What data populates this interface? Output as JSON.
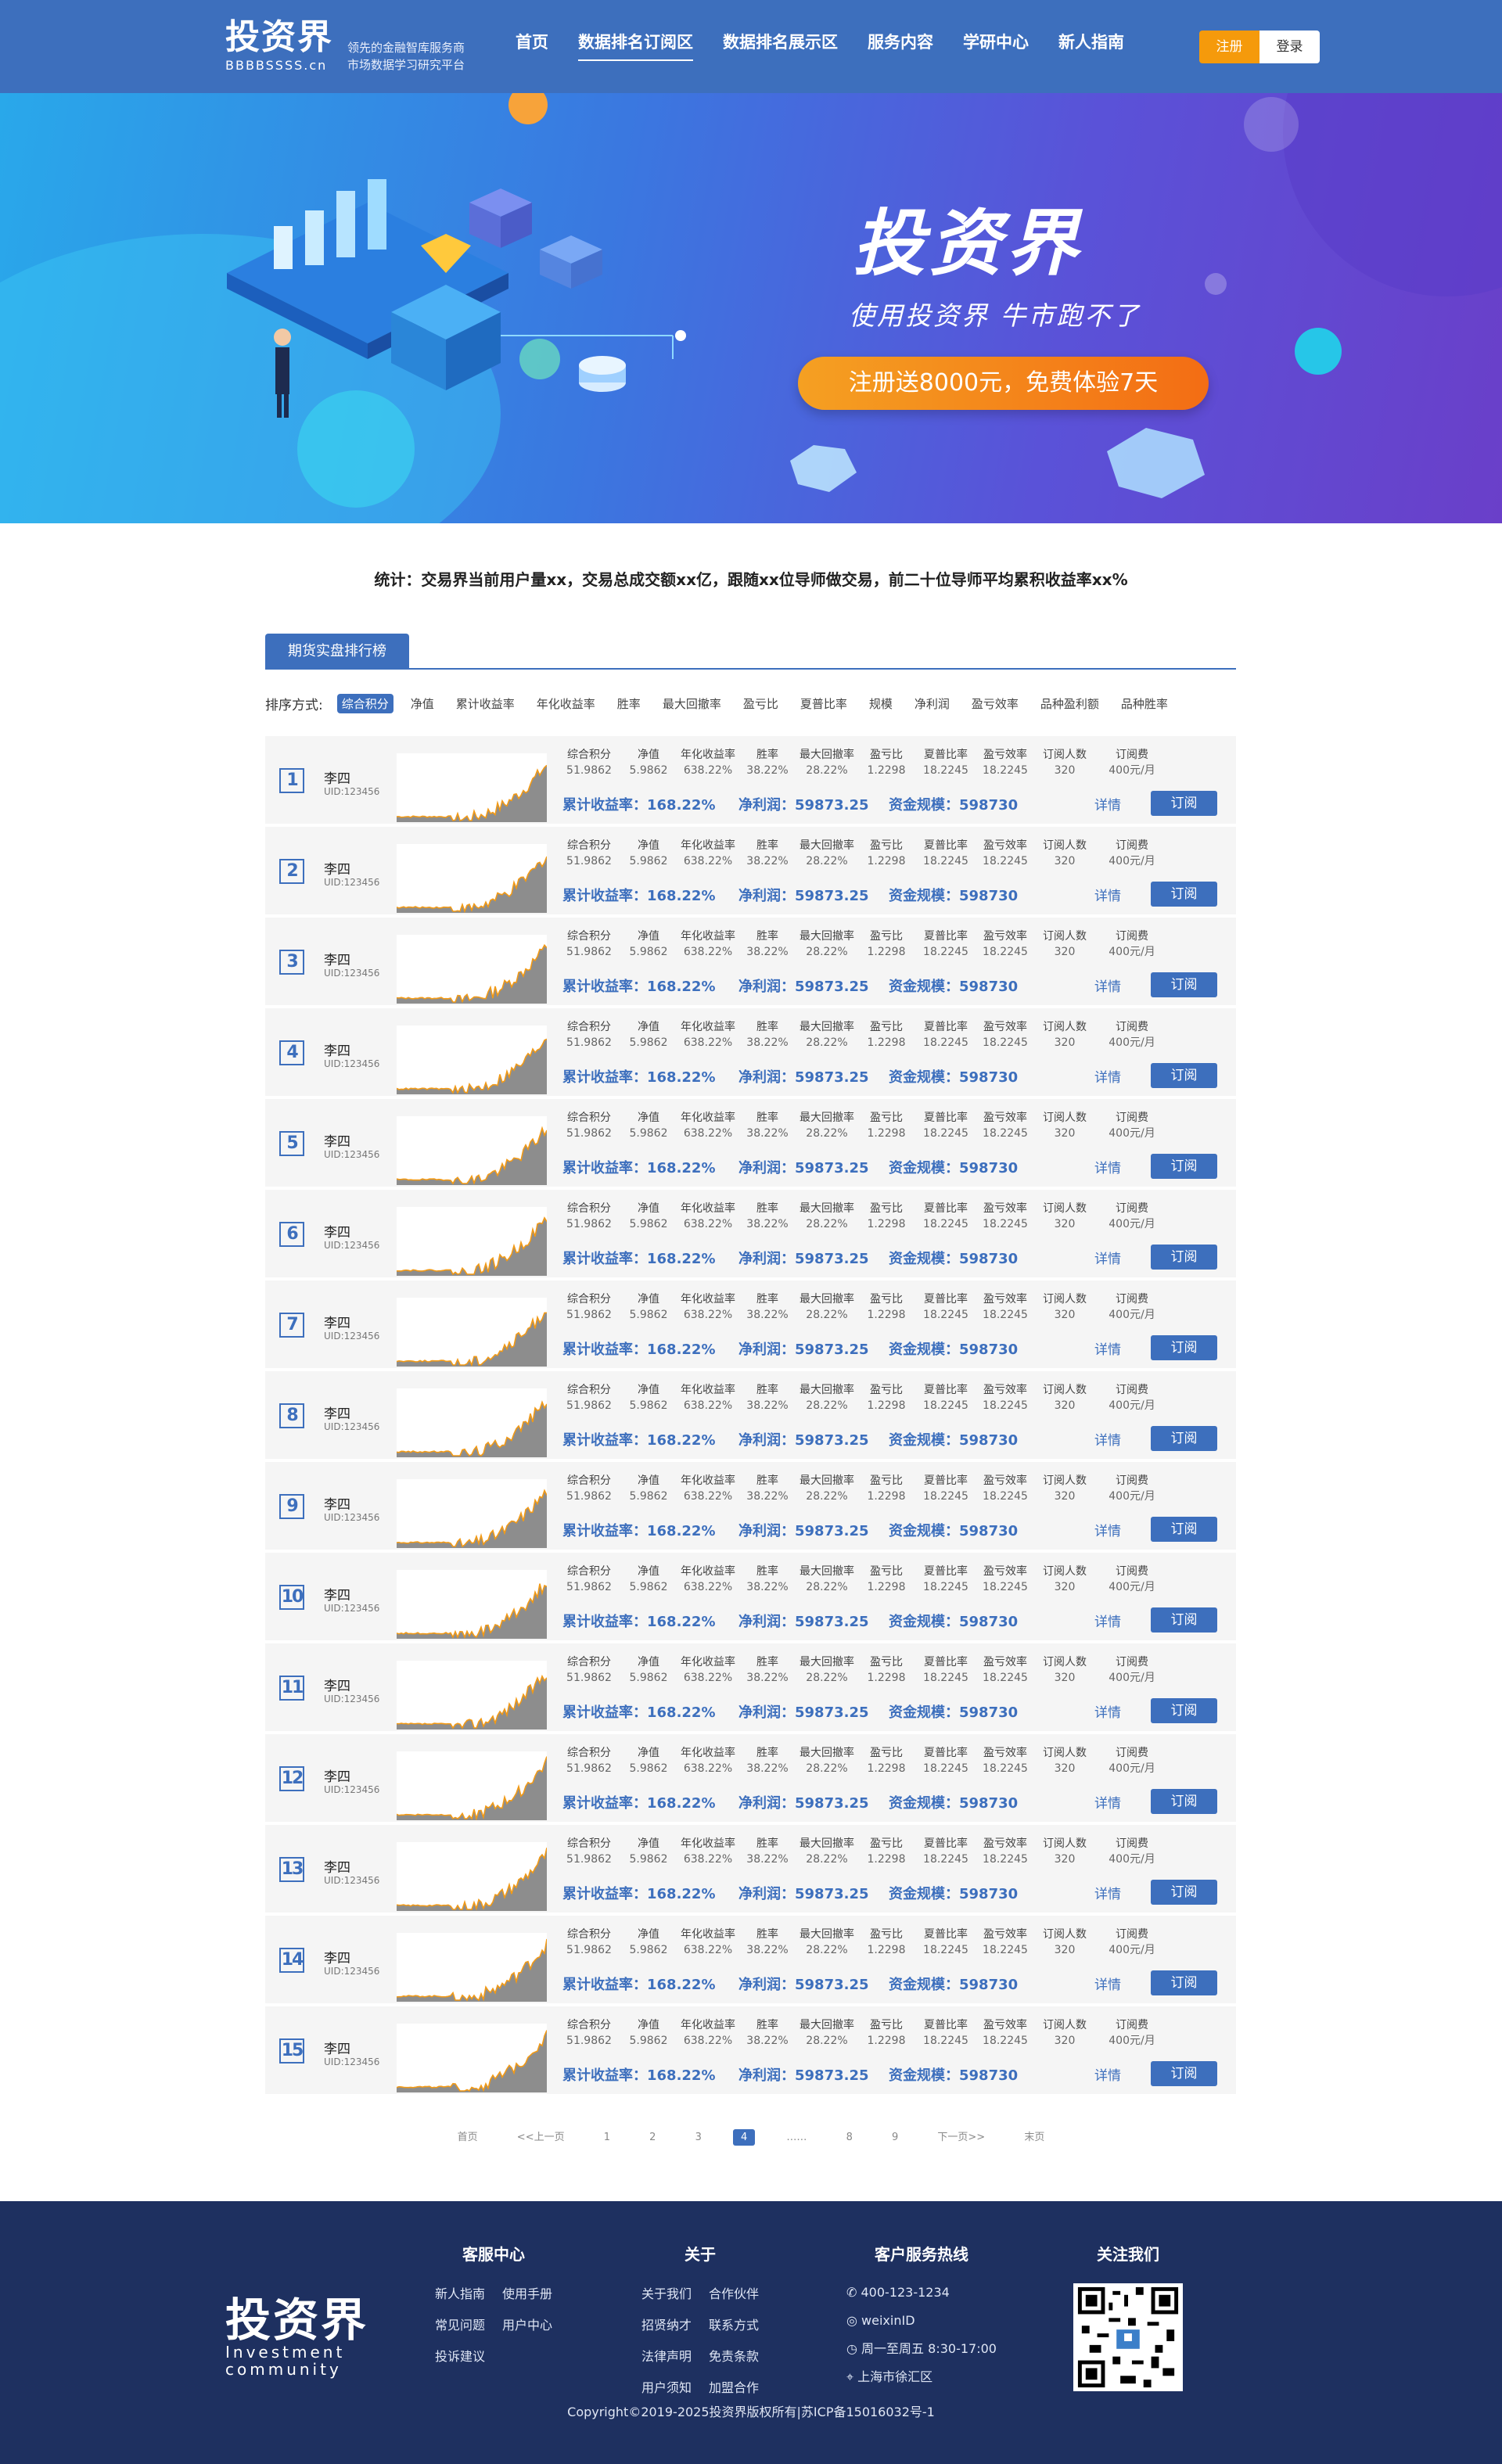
{
  "header": {
    "logo": "投资界",
    "logo_sub": "BBBBSSSS.cn",
    "slogan": [
      "领先的金融智库服务商",
      "市场数据学习研究平台"
    ],
    "nav": [
      {
        "label": "首页"
      },
      {
        "label": "数据排名订阅区",
        "active": true
      },
      {
        "label": "数据排名展示区"
      },
      {
        "label": "服务内容"
      },
      {
        "label": "学研中心"
      },
      {
        "label": "新人指南"
      }
    ],
    "register": "注册",
    "login": "登录"
  },
  "banner": {
    "title": "投资界",
    "subtitle": "使用投资界 牛市跑不了",
    "cta": "注册送8000元，免费体验7天"
  },
  "stats": "统计：交易界当前用户量xx，交易总成交额xx亿，跟随xx位导师做交易，前二十位导师平均累积收益率xx%",
  "tab": "期货实盘排行榜",
  "sort": {
    "label": "排序方式:",
    "options": [
      {
        "label": "综合积分",
        "active": true
      },
      {
        "label": "净值"
      },
      {
        "label": "累计收益率"
      },
      {
        "label": "年化收益率"
      },
      {
        "label": "胜率"
      },
      {
        "label": "最大回撤率"
      },
      {
        "label": "盈亏比"
      },
      {
        "label": "夏普比率"
      },
      {
        "label": "规模"
      },
      {
        "label": "净利润"
      },
      {
        "label": "盈亏效率"
      },
      {
        "label": "品种盈利额"
      },
      {
        "label": "品种胜率"
      }
    ]
  },
  "metric_headers": [
    "综合积分",
    "净值",
    "年化收益率",
    "胜率",
    "最大回撤率",
    "盈亏比",
    "夏普比率",
    "盈亏效率",
    "订阅人数",
    "订阅费"
  ],
  "metric_values": [
    "51.9862",
    "5.9862",
    "638.22%",
    "38.22%",
    "28.22%",
    "1.2298",
    "18.2245",
    "18.2245",
    "320",
    "400元/月"
  ],
  "highlights": {
    "return": "累计收益率：168.22%",
    "profit": "净利润：59873.25",
    "scale": "资金规模：598730"
  },
  "detail_label": "详情",
  "subscribe_label": "订阅",
  "ranking": [
    {
      "rank": "1",
      "name": "李四",
      "uid": "UID:123456"
    },
    {
      "rank": "2",
      "name": "李四",
      "uid": "UID:123456"
    },
    {
      "rank": "3",
      "name": "李四",
      "uid": "UID:123456"
    },
    {
      "rank": "4",
      "name": "李四",
      "uid": "UID:123456"
    },
    {
      "rank": "5",
      "name": "李四",
      "uid": "UID:123456"
    },
    {
      "rank": "6",
      "name": "李四",
      "uid": "UID:123456"
    },
    {
      "rank": "7",
      "name": "李四",
      "uid": "UID:123456"
    },
    {
      "rank": "8",
      "name": "李四",
      "uid": "UID:123456"
    },
    {
      "rank": "9",
      "name": "李四",
      "uid": "UID:123456"
    },
    {
      "rank": "10",
      "name": "李四",
      "uid": "UID:123456"
    },
    {
      "rank": "11",
      "name": "李四",
      "uid": "UID:123456"
    },
    {
      "rank": "12",
      "name": "李四",
      "uid": "UID:123456"
    },
    {
      "rank": "13",
      "name": "李四",
      "uid": "UID:123456"
    },
    {
      "rank": "14",
      "name": "李四",
      "uid": "UID:123456"
    },
    {
      "rank": "15",
      "name": "李四",
      "uid": "UID:123456"
    }
  ],
  "pagination": [
    {
      "label": "首页"
    },
    {
      "label": "<<上一页"
    },
    {
      "label": "1"
    },
    {
      "label": "2"
    },
    {
      "label": "3"
    },
    {
      "label": "4",
      "active": true
    },
    {
      "label": "……"
    },
    {
      "label": "8"
    },
    {
      "label": "9"
    },
    {
      "label": "下一页>>"
    },
    {
      "label": "末页"
    }
  ],
  "footer": {
    "logo": "投资界",
    "logo_en": [
      "Investment",
      "community"
    ],
    "service": {
      "title": "客服中心",
      "links": [
        "新人指南",
        "使用手册",
        "常见问题",
        "用户中心",
        "投诉建议"
      ]
    },
    "about": {
      "title": "关于",
      "links": [
        "关于我们",
        "合作伙伴",
        "招贤纳才",
        "联系方式",
        "法律声明",
        "免责条款",
        "用户须知",
        "加盟合作"
      ]
    },
    "hotline": {
      "title": "客户服务热线",
      "items": [
        {
          "icon": "phone-icon",
          "text": "400-123-1234"
        },
        {
          "icon": "wechat-icon",
          "text": "weixinID"
        },
        {
          "icon": "clock-icon",
          "text": "周一至周五 8:30-17:00"
        },
        {
          "icon": "location-icon",
          "text": "上海市徐汇区"
        }
      ]
    },
    "follow": {
      "title": "关注我们"
    },
    "copyright": "Copyright©2019-2025投资界版权所有|苏ICP备15016032号-1"
  },
  "colors": {
    "primary": "#3d6fbd",
    "accent": "#f59a0b",
    "footer": "#1e3060"
  }
}
